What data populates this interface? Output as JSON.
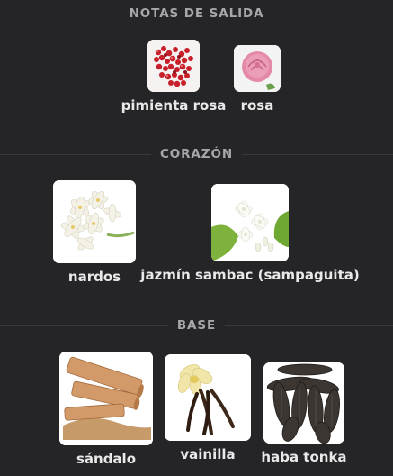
{
  "sections": [
    {
      "title": "NOTAS DE SALIDA",
      "notes": [
        {
          "name": "pimienta rosa",
          "icon": "pink-pepper-image"
        },
        {
          "name": "rosa",
          "icon": "rose-image"
        }
      ]
    },
    {
      "title": "CORAZÓN",
      "notes": [
        {
          "name": "nardos",
          "icon": "tuberose-image"
        },
        {
          "name": "jazmín sambac (sampaguita)",
          "icon": "jasmine-sambac-image"
        }
      ]
    },
    {
      "title": "BASE",
      "notes": [
        {
          "name": "sándalo",
          "icon": "sandalwood-image"
        },
        {
          "name": "vainilla",
          "icon": "vanilla-image"
        },
        {
          "name": "haba tonka",
          "icon": "tonka-bean-image"
        }
      ]
    }
  ],
  "colors": {
    "background": "#252427",
    "header_text": "#a7a7ab",
    "label_text": "#e9e9ea"
  }
}
